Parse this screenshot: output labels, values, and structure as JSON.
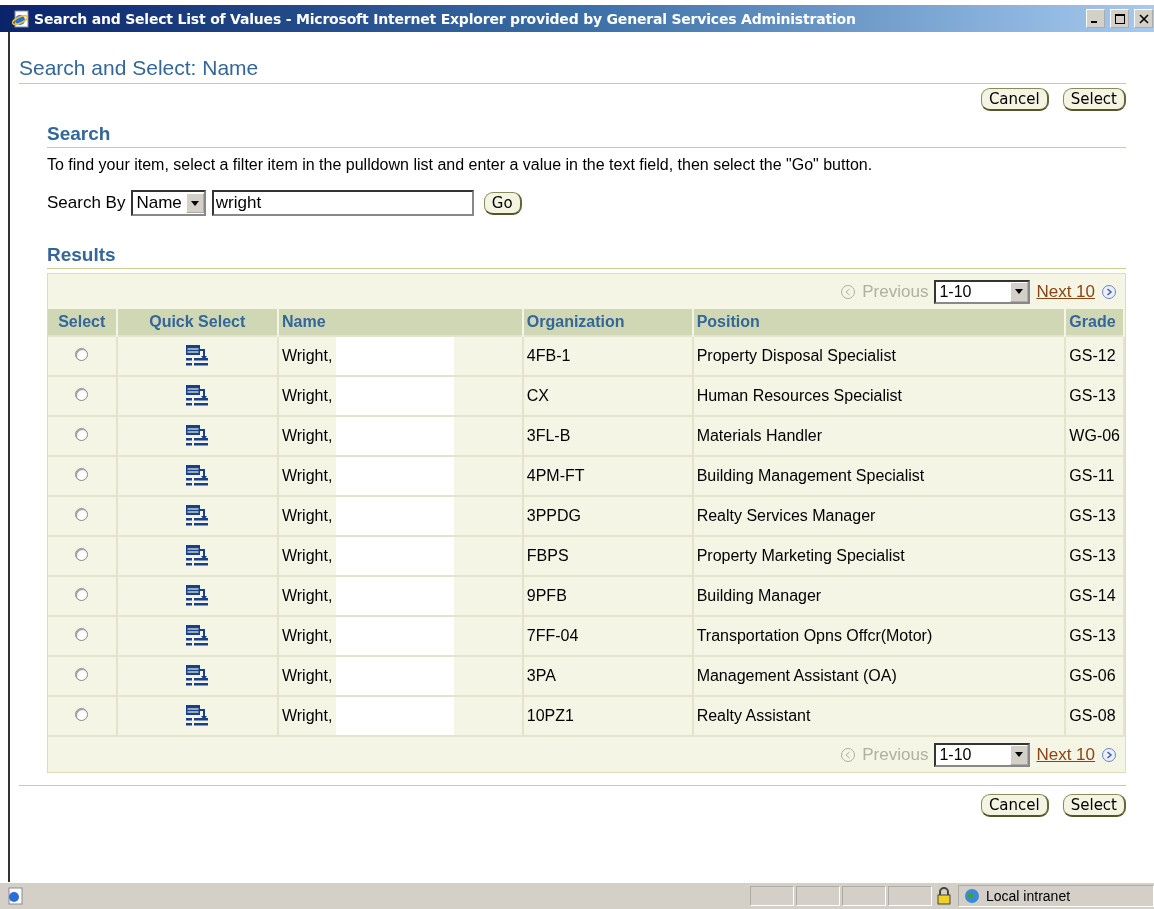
{
  "window": {
    "title": "Search and Select List of Values - Microsoft Internet Explorer provided by General Services Administration"
  },
  "page_title": "Search and Select: Name",
  "top_buttons": [
    "Cancel",
    "Select"
  ],
  "search": {
    "heading": "Search",
    "instructions": "To find your item, select a filter item in the pulldown list and enter a value in the text field, then select the \"Go\" button.",
    "label": "Search By",
    "filter": "Name",
    "value": "wright",
    "go": "Go"
  },
  "results": {
    "heading": "Results",
    "nav_top": {
      "previous": "Previous",
      "previous_disabled": true,
      "range": "1-10",
      "next": "Next 10"
    },
    "columns": [
      "Select",
      "Quick Select",
      "Name",
      "Organization",
      "Position",
      "Grade"
    ],
    "rows": [
      {
        "selected": false,
        "name": "Wright,",
        "organization": "4FB-1",
        "position": "Property Disposal Specialist",
        "grade": "GS-12"
      },
      {
        "selected": false,
        "name": "Wright,",
        "organization": "CX",
        "position": "Human Resources Specialist",
        "grade": "GS-13"
      },
      {
        "selected": false,
        "name": "Wright,",
        "organization": "3FL-B",
        "position": "Materials Handler",
        "grade": "WG-06"
      },
      {
        "selected": false,
        "name": "Wright,",
        "organization": "4PM-FT",
        "position": "Building Management Specialist",
        "grade": "GS-11"
      },
      {
        "selected": false,
        "name": "Wright,",
        "organization": "3PPDG",
        "position": "Realty Services Manager",
        "grade": "GS-13"
      },
      {
        "selected": false,
        "name": "Wright,",
        "organization": "FBPS",
        "position": "Property Marketing Specialist",
        "grade": "GS-13"
      },
      {
        "selected": false,
        "name": "Wright,",
        "organization": "9PFB",
        "position": "Building Manager",
        "grade": "GS-14"
      },
      {
        "selected": false,
        "name": "Wright,",
        "organization": "7FF-04",
        "position": "Transportation Opns Offcr(Motor)",
        "grade": "GS-13"
      },
      {
        "selected": false,
        "name": "Wright,",
        "organization": "3PA",
        "position": "Management Assistant (OA)",
        "grade": "GS-06"
      },
      {
        "selected": false,
        "name": "Wright,",
        "organization": "10PZ1",
        "position": "Realty Assistant",
        "grade": "GS-08"
      }
    ],
    "nav_bottom": {
      "previous": "Previous",
      "previous_disabled": true,
      "range": "1-10",
      "next": "Next 10"
    }
  },
  "bottom_buttons": [
    "Cancel",
    "Select"
  ],
  "status_bar": {
    "zone": "Local intranet"
  }
}
